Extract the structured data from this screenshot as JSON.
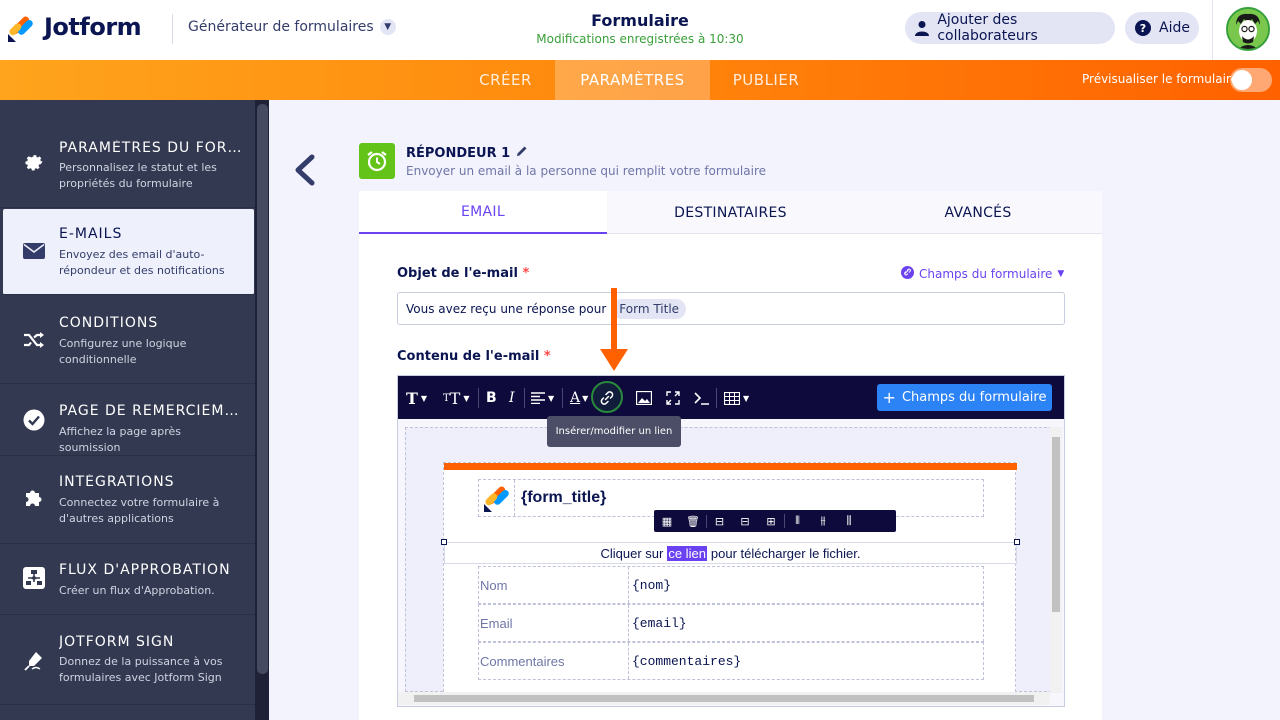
{
  "header": {
    "brand": "Jotform",
    "builder_label": "Générateur de formulaires",
    "title": "Formulaire",
    "saved_status": "Modifications enregistrées à 10:30",
    "collaborators_label": "Ajouter des collaborateurs",
    "help_label": "Aide"
  },
  "nav": {
    "tabs": [
      {
        "label": "CRÉER"
      },
      {
        "label": "PARAMÈTRES"
      },
      {
        "label": "PUBLIER"
      }
    ],
    "active_tab": "PARAMÈTRES",
    "preview_label": "Prévisualiser le formulaire",
    "preview_enabled": false
  },
  "sidebar": {
    "items": [
      {
        "label": "PARAMÈTRES DU FORMULAIRE",
        "desc": "Personnalisez le statut et les propriétés du formulaire",
        "icon": "gear-icon"
      },
      {
        "label": "E-MAILS",
        "desc": "Envoyez des email d'auto-répondeur et des notifications",
        "icon": "envelope-icon"
      },
      {
        "label": "CONDITIONS",
        "desc": "Configurez une logique conditionnelle",
        "icon": "shuffle-icon"
      },
      {
        "label": "PAGE DE REMERCIEMENT",
        "desc": "Affichez la page après soumission",
        "icon": "check-circle-icon"
      },
      {
        "label": "INTÉGRATIONS",
        "desc": "Connectez votre formulaire à d'autres applications",
        "icon": "puzzle-icon"
      },
      {
        "label": "FLUX D'APPROBATION",
        "desc": "Créer un flux d'Approbation.",
        "icon": "flow-icon"
      },
      {
        "label": "JOTFORM SIGN",
        "desc": "Donnez de la puissance à vos formulaires avec Jotform Sign",
        "icon": "pen-icon"
      }
    ],
    "active_index": 1
  },
  "responder": {
    "title": "RÉPONDEUR 1",
    "subtitle": "Envoyer un email à la personne qui remplit votre formulaire"
  },
  "tabs": {
    "items": [
      {
        "label": "EMAIL"
      },
      {
        "label": "DESTINATAIRES"
      },
      {
        "label": "AVANCÉS"
      }
    ],
    "active": "EMAIL"
  },
  "form": {
    "subject_label": "Objet de l'e-mail",
    "required_mark": "*",
    "fields_link": "Champs du formulaire",
    "subject_text": "Vous avez reçu une réponse pour",
    "subject_tag": "Form Title",
    "content_label": "Contenu de l'e-mail"
  },
  "editor": {
    "add_field_button": "Champs du formulaire",
    "tooltip": "Insérer/modifier un lien",
    "form_title_var": "{form_title}",
    "click_text_before": "Cliquer sur",
    "link_text": "ce lien",
    "click_text_after": "pour télécharger le fichier.",
    "rows": [
      {
        "key": "Nom",
        "value": "{nom}"
      },
      {
        "key": "Email",
        "value": "{email}"
      },
      {
        "key": "Commentaires",
        "value": "{commentaires}"
      }
    ]
  },
  "colors": {
    "accent": "#6a42f1",
    "brand_orange": "#ff6100",
    "sidebar_bg": "#333950",
    "toolbar_bg": "#0e0a3b",
    "button_blue": "#2c83f6",
    "responder_green": "#64c319"
  }
}
